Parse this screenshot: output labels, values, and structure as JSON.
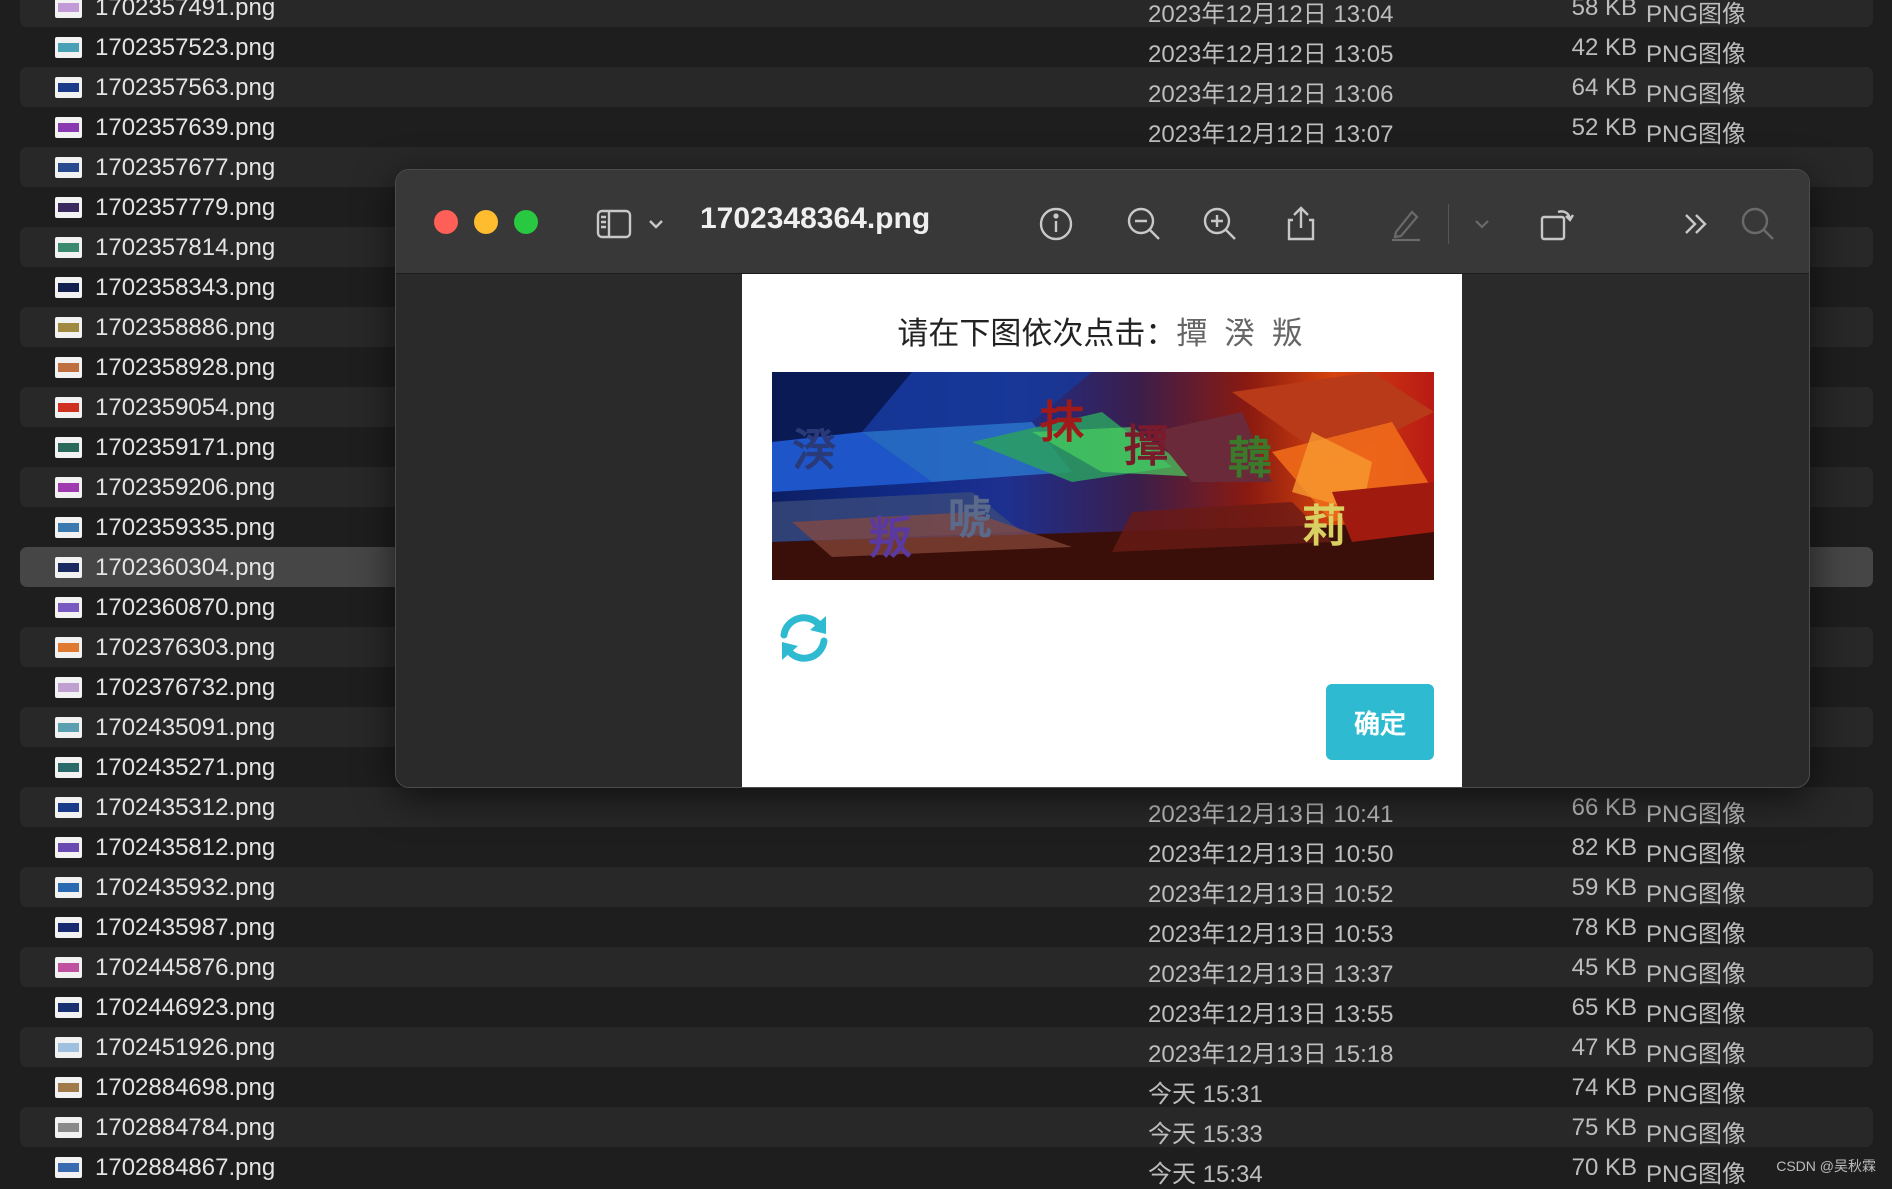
{
  "finder": {
    "files": [
      {
        "name": "1702357491.png",
        "date": "2023年12月12日 13:04",
        "size": "58 KB",
        "kind": "PNG图像",
        "stripe": "#c29ad8"
      },
      {
        "name": "1702357523.png",
        "date": "2023年12月12日 13:05",
        "size": "42 KB",
        "kind": "PNG图像",
        "stripe": "#4aa0b4"
      },
      {
        "name": "1702357563.png",
        "date": "2023年12月12日 13:06",
        "size": "64 KB",
        "kind": "PNG图像",
        "stripe": "#1c3a8a"
      },
      {
        "name": "1702357639.png",
        "date": "2023年12月12日 13:07",
        "size": "52 KB",
        "kind": "PNG图像",
        "stripe": "#8a3ab0"
      },
      {
        "name": "1702357677.png",
        "date": "",
        "size": "",
        "kind": "",
        "stripe": "#2a4a90"
      },
      {
        "name": "1702357779.png",
        "date": "",
        "size": "",
        "kind": "",
        "stripe": "#3a2a60"
      },
      {
        "name": "1702357814.png",
        "date": "",
        "size": "",
        "kind": "",
        "stripe": "#3a8a70"
      },
      {
        "name": "1702358343.png",
        "date": "",
        "size": "",
        "kind": "",
        "stripe": "#142050"
      },
      {
        "name": "1702358886.png",
        "date": "",
        "size": "",
        "kind": "",
        "stripe": "#a08a40"
      },
      {
        "name": "1702358928.png",
        "date": "",
        "size": "",
        "kind": "",
        "stripe": "#c07040"
      },
      {
        "name": "1702359054.png",
        "date": "",
        "size": "",
        "kind": "",
        "stripe": "#d03020"
      },
      {
        "name": "1702359171.png",
        "date": "",
        "size": "",
        "kind": "",
        "stripe": "#2a6a5a"
      },
      {
        "name": "1702359206.png",
        "date": "",
        "size": "",
        "kind": "",
        "stripe": "#a03ab0"
      },
      {
        "name": "1702359335.png",
        "date": "",
        "size": "",
        "kind": "",
        "stripe": "#3a7ab0"
      },
      {
        "name": "1702360304.png",
        "date": "",
        "size": "",
        "kind": "",
        "stripe": "#1a2a60",
        "selected": true
      },
      {
        "name": "1702360870.png",
        "date": "",
        "size": "",
        "kind": "",
        "stripe": "#7a5ac0"
      },
      {
        "name": "1702376303.png",
        "date": "",
        "size": "",
        "kind": "",
        "stripe": "#e07a30"
      },
      {
        "name": "1702376732.png",
        "date": "",
        "size": "",
        "kind": "",
        "stripe": "#c0a0d0"
      },
      {
        "name": "1702435091.png",
        "date": "",
        "size": "",
        "kind": "",
        "stripe": "#5aa0b0"
      },
      {
        "name": "1702435271.png",
        "date": "",
        "size": "",
        "kind": "",
        "stripe": "#2a6a6a"
      },
      {
        "name": "1702435312.png",
        "date": "2023年12月13日 10:41",
        "size": "66 KB",
        "kind": "PNG图像",
        "stripe": "#1a3a8a"
      },
      {
        "name": "1702435812.png",
        "date": "2023年12月13日 10:50",
        "size": "82 KB",
        "kind": "PNG图像",
        "stripe": "#6a4ab0"
      },
      {
        "name": "1702435932.png",
        "date": "2023年12月13日 10:52",
        "size": "59 KB",
        "kind": "PNG图像",
        "stripe": "#2a6ab0"
      },
      {
        "name": "1702435987.png",
        "date": "2023年12月13日 10:53",
        "size": "78 KB",
        "kind": "PNG图像",
        "stripe": "#1a2a70"
      },
      {
        "name": "1702445876.png",
        "date": "2023年12月13日 13:37",
        "size": "45 KB",
        "kind": "PNG图像",
        "stripe": "#c050a0"
      },
      {
        "name": "1702446923.png",
        "date": "2023年12月13日 13:55",
        "size": "65 KB",
        "kind": "PNG图像",
        "stripe": "#1a3070"
      },
      {
        "name": "1702451926.png",
        "date": "2023年12月13日 15:18",
        "size": "47 KB",
        "kind": "PNG图像",
        "stripe": "#a0c0e0"
      },
      {
        "name": "1702884698.png",
        "date": "今天 15:31",
        "size": "74 KB",
        "kind": "PNG图像",
        "stripe": "#a07a4a"
      },
      {
        "name": "1702884784.png",
        "date": "今天 15:33",
        "size": "75 KB",
        "kind": "PNG图像",
        "stripe": "#8a8a8a"
      },
      {
        "name": "1702884867.png",
        "date": "今天 15:34",
        "size": "70 KB",
        "kind": "PNG图像",
        "stripe": "#3a6ab0"
      }
    ]
  },
  "preview": {
    "title": "1702348364.png",
    "traffic_colors": {
      "close": "#fe5f57",
      "minimize": "#febc2e",
      "zoom": "#28c840"
    },
    "toolbar_icons": [
      "sidebar-icon",
      "chevron-down-icon",
      "info-icon",
      "zoom-out-icon",
      "zoom-in-icon",
      "share-icon",
      "markup-pen-icon",
      "chevron-down-icon",
      "rotate-icon",
      "more-icon",
      "search-icon"
    ]
  },
  "captcha": {
    "instruction_prefix": "请在下图依次点击：",
    "targets": "撢 湀 叛",
    "glyphs": [
      "湀",
      "抹",
      "撢",
      "韓",
      "叛",
      "唬",
      "莉"
    ],
    "confirm_label": "确定",
    "accent_color": "#2ebad0"
  },
  "watermark": "CSDN @吴秋霖"
}
